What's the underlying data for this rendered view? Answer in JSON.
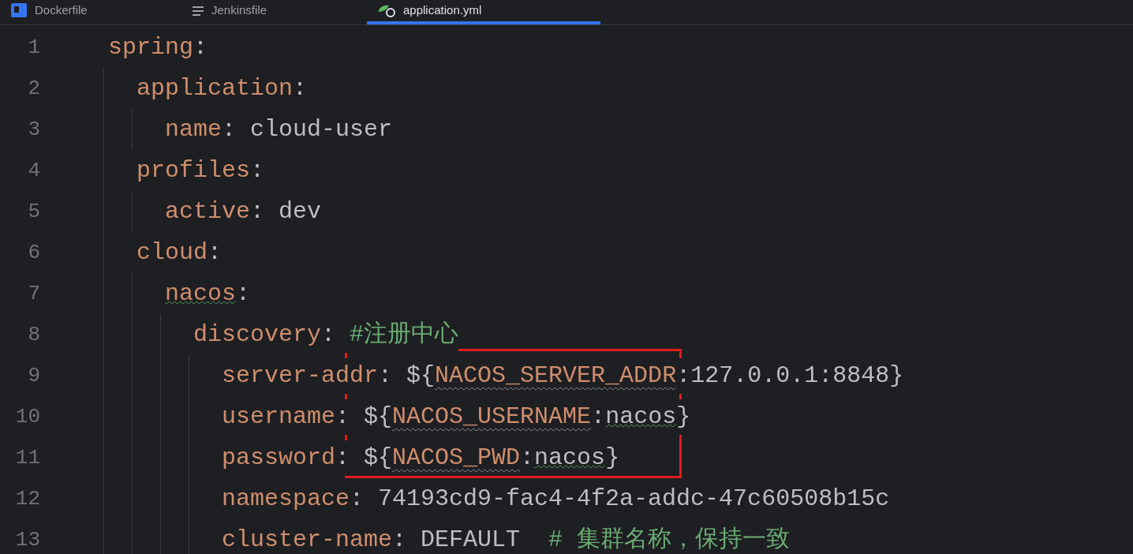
{
  "tabs": [
    {
      "label": "Dockerfile",
      "kind": "docker",
      "selected": false
    },
    {
      "label": "Jenkinsfile",
      "kind": "jenkins",
      "selected": false
    },
    {
      "label": "application.yml",
      "kind": "yaml",
      "selected": true
    }
  ],
  "lines": [
    {
      "number": "1",
      "tokens": [
        {
          "kind": "key",
          "text": "spring",
          "warning": false
        },
        {
          "kind": "punct",
          "text": ":",
          "warning": false
        }
      ],
      "children": [
        {
          "number": "2",
          "tokens": [
            {
              "kind": "key",
              "text": "application",
              "warning": false
            },
            {
              "kind": "punct",
              "text": ":",
              "warning": false
            }
          ],
          "children": [
            {
              "number": "3",
              "tokens": [
                {
                  "kind": "key",
                  "text": "name",
                  "warning": false
                },
                {
                  "kind": "punct",
                  "text": ": ",
                  "warning": false
                },
                {
                  "kind": "value",
                  "text": "cloud-user",
                  "warning": false
                }
              ]
            }
          ]
        },
        {
          "number": "4",
          "tokens": [
            {
              "kind": "key",
              "text": "profiles",
              "warning": false
            },
            {
              "kind": "punct",
              "text": ":",
              "warning": false
            }
          ],
          "children": [
            {
              "number": "5",
              "tokens": [
                {
                  "kind": "key",
                  "text": "active",
                  "warning": false
                },
                {
                  "kind": "punct",
                  "text": ": ",
                  "warning": false
                },
                {
                  "kind": "value",
                  "text": "dev",
                  "warning": false
                }
              ]
            }
          ]
        },
        {
          "number": "6",
          "tokens": [
            {
              "kind": "key",
              "text": "cloud",
              "warning": false
            },
            {
              "kind": "punct",
              "text": ":",
              "warning": false
            }
          ],
          "children": [
            {
              "number": "7",
              "tokens": [
                {
                  "kind": "key",
                  "text": "nacos",
                  "warning": true
                },
                {
                  "kind": "punct",
                  "text": ":",
                  "warning": false
                }
              ],
              "children": [
                {
                  "number": "8",
                  "tokens": [
                    {
                      "kind": "key",
                      "text": "discovery",
                      "warning": false
                    },
                    {
                      "kind": "punct",
                      "text": ": ",
                      "warning": false
                    },
                    {
                      "kind": "comment",
                      "text": "#注册中心",
                      "warning": false
                    }
                  ],
                  "children": [
                    {
                      "number": "9",
                      "tokens": [
                        {
                          "kind": "key",
                          "text": "server-addr",
                          "warning": false
                        },
                        {
                          "kind": "punct",
                          "text": ": ",
                          "warning": false
                        },
                        {
                          "kind": "value",
                          "text": "${",
                          "warning": false
                        },
                        {
                          "kind": "env",
                          "text": "NACOS_SERVER_ADDR",
                          "warning": true
                        },
                        {
                          "kind": "value",
                          "text": ":127.0.0.1:8848}",
                          "warning": false
                        }
                      ]
                    },
                    {
                      "number": "10",
                      "tokens": [
                        {
                          "kind": "key",
                          "text": "username",
                          "warning": false
                        },
                        {
                          "kind": "punct",
                          "text": ": ",
                          "warning": false
                        },
                        {
                          "kind": "value",
                          "text": "${",
                          "warning": false
                        },
                        {
                          "kind": "env",
                          "text": "NACOS_USERNAME",
                          "warning": true
                        },
                        {
                          "kind": "value",
                          "text": ":",
                          "warning": false
                        },
                        {
                          "kind": "value",
                          "text": "nacos",
                          "warning": true
                        },
                        {
                          "kind": "value",
                          "text": "}",
                          "warning": false
                        }
                      ]
                    },
                    {
                      "number": "11",
                      "tokens": [
                        {
                          "kind": "key",
                          "text": "password",
                          "warning": false
                        },
                        {
                          "kind": "punct",
                          "text": ": ",
                          "warning": false
                        },
                        {
                          "kind": "value",
                          "text": "${",
                          "warning": false
                        },
                        {
                          "kind": "env",
                          "text": "NACOS_PWD",
                          "warning": true
                        },
                        {
                          "kind": "value",
                          "text": ":",
                          "warning": false
                        },
                        {
                          "kind": "value",
                          "text": "nacos",
                          "warning": true
                        },
                        {
                          "kind": "value",
                          "text": "}",
                          "warning": false
                        }
                      ]
                    },
                    {
                      "number": "12",
                      "tokens": [
                        {
                          "kind": "key",
                          "text": "namespace",
                          "warning": false
                        },
                        {
                          "kind": "punct",
                          "text": ": ",
                          "warning": false
                        },
                        {
                          "kind": "value",
                          "text": "74193cd9-fac4-4f2a-addc-47c60508b15c",
                          "warning": false
                        }
                      ]
                    },
                    {
                      "number": "13",
                      "tokens": [
                        {
                          "kind": "key",
                          "text": "cluster-name",
                          "warning": false
                        },
                        {
                          "kind": "punct",
                          "text": ": ",
                          "warning": false
                        },
                        {
                          "kind": "value",
                          "text": "DEFAULT",
                          "warning": false
                        },
                        {
                          "kind": "comment",
                          "text": "  # 集群名称，保持一致",
                          "warning": false
                        }
                      ]
                    }
                  ]
                }
              ]
            }
          ]
        }
      ]
    }
  ]
}
